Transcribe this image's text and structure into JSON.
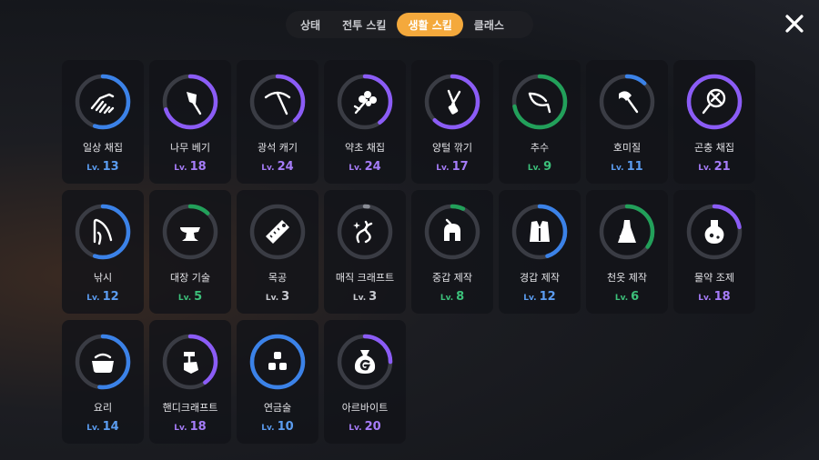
{
  "tabs": [
    {
      "label": "상태",
      "active": false
    },
    {
      "label": "전투 스킬",
      "active": false
    },
    {
      "label": "생활 스킬",
      "active": true
    },
    {
      "label": "클래스",
      "active": false
    }
  ],
  "level_prefix": "Lv.",
  "skills": [
    {
      "name": "일상 채집",
      "level": "13",
      "progress": 0.55,
      "color": "#3b82e8",
      "icon": "hand-icon"
    },
    {
      "name": "나무 베기",
      "level": "18",
      "progress": 0.7,
      "color": "#8b5cf6",
      "icon": "axe-icon"
    },
    {
      "name": "광석 캐기",
      "level": "24",
      "progress": 0.38,
      "color": "#8b5cf6",
      "icon": "pickaxe-icon"
    },
    {
      "name": "약초 채집",
      "level": "24",
      "progress": 0.4,
      "color": "#8b5cf6",
      "icon": "herb-icon"
    },
    {
      "name": "양털 깎기",
      "level": "17",
      "progress": 0.62,
      "color": "#8b5cf6",
      "icon": "shears-icon"
    },
    {
      "name": "추수",
      "level": "9",
      "progress": 0.72,
      "color": "#22a05a",
      "icon": "sickle-icon"
    },
    {
      "name": "호미질",
      "level": "11",
      "progress": 0.12,
      "color": "#3b82e8",
      "icon": "hoe-icon"
    },
    {
      "name": "곤충 채집",
      "level": "21",
      "progress": 1.0,
      "color": "#8b5cf6",
      "icon": "net-icon"
    },
    {
      "name": "낚시",
      "level": "12",
      "progress": 0.55,
      "color": "#3b82e8",
      "icon": "fishing-rod-icon"
    },
    {
      "name": "대장 기술",
      "level": "5",
      "progress": 0.12,
      "color": "#22a05a",
      "icon": "anvil-icon"
    },
    {
      "name": "목공",
      "level": "3",
      "progress": 0.0,
      "color": "#8a8d96",
      "icon": "saw-icon"
    },
    {
      "name": "매직 크래프트",
      "level": "3",
      "progress": 0.02,
      "color": "#8a8d96",
      "icon": "magic-thread-icon"
    },
    {
      "name": "중갑 제작",
      "level": "8",
      "progress": 0.07,
      "color": "#22a05a",
      "icon": "helmet-icon"
    },
    {
      "name": "경갑 제작",
      "level": "12",
      "progress": 0.45,
      "color": "#3b82e8",
      "icon": "vest-icon"
    },
    {
      "name": "천옷 제작",
      "level": "6",
      "progress": 0.35,
      "color": "#22a05a",
      "icon": "dress-icon"
    },
    {
      "name": "물약 조제",
      "level": "18",
      "progress": 0.22,
      "color": "#8b5cf6",
      "icon": "potion-icon"
    },
    {
      "name": "요리",
      "level": "14",
      "progress": 0.52,
      "color": "#3b82e8",
      "icon": "pot-icon"
    },
    {
      "name": "핸디크래프트",
      "level": "18",
      "progress": 0.4,
      "color": "#8b5cf6",
      "icon": "hand-hammer-icon"
    },
    {
      "name": "연금술",
      "level": "10",
      "progress": 1.0,
      "color": "#3b82e8",
      "icon": "blocks-icon"
    },
    {
      "name": "아르바이트",
      "level": "20",
      "progress": 0.25,
      "color": "#8b5cf6",
      "icon": "money-bag-icon"
    }
  ]
}
